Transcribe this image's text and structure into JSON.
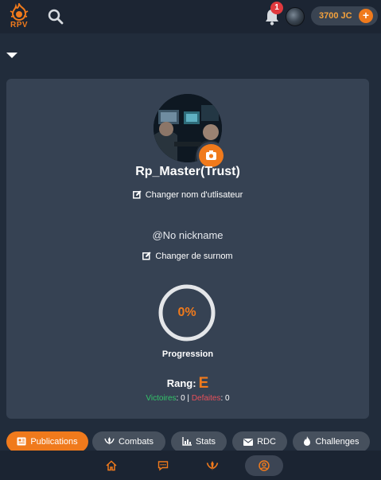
{
  "header": {
    "logo_text": "RPV",
    "notification_count": "1",
    "coins_label": "3700 JC",
    "coins_add": "+"
  },
  "profile": {
    "username": "Rp_Master(Trust)",
    "change_username": "Changer nom d'utlisateur",
    "nickname": "@No nickname",
    "change_nickname": "Changer de surnom",
    "progress_percent": 0,
    "progress_text": "0%",
    "progress_label": "Progression",
    "rank_label": "Rang:",
    "rank_value": "E",
    "victories_label": "Victoires",
    "victories_value": ": 0",
    "separator": " | ",
    "defeats_label": "Defaites",
    "defeats_value": ": 0"
  },
  "tabs": [
    {
      "label": "Publications",
      "icon": "newspaper-icon"
    },
    {
      "label": "Combats",
      "icon": "swords-icon"
    },
    {
      "label": "Stats",
      "icon": "chart-icon"
    },
    {
      "label": "RDC",
      "icon": "envelope-icon"
    },
    {
      "label": "Challenges",
      "icon": "fire-icon"
    }
  ],
  "bottom_nav": [
    {
      "icon": "home-icon"
    },
    {
      "icon": "chat-icon"
    },
    {
      "icon": "swords-icon"
    },
    {
      "icon": "user-circle-icon",
      "active": true
    }
  ],
  "colors": {
    "accent": "#f07a1c",
    "background": "#212c3b",
    "card": "#364253",
    "victory": "#33c46a",
    "defeat": "#e8505b"
  }
}
